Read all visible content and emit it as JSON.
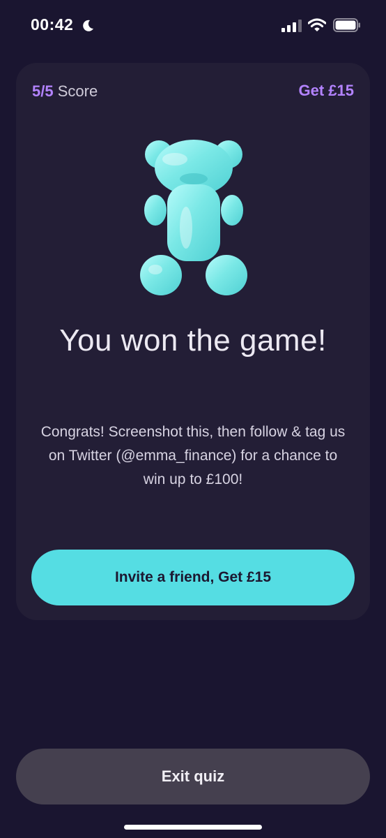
{
  "status_bar": {
    "time": "00:42",
    "icons": [
      "moon-icon",
      "cellular-signal-icon",
      "wifi-icon",
      "battery-icon"
    ]
  },
  "card": {
    "score_value": "5/5",
    "score_label": "Score",
    "reward_label": "Get £15",
    "illustration": "gummy-bear-icon",
    "headline": "You won the game!",
    "body": "Congrats! Screenshot this, then follow & tag us on Twitter (@emma_finance) for a chance to win up to £100!",
    "invite_button_label": "Invite a friend, Get £15"
  },
  "footer": {
    "exit_button_label": "Exit quiz"
  },
  "colors": {
    "background": "#1a1530",
    "card": "#231e36",
    "accent_purple": "#b383ff",
    "accent_cyan": "#55dde3",
    "exit_button": "#45404f"
  }
}
